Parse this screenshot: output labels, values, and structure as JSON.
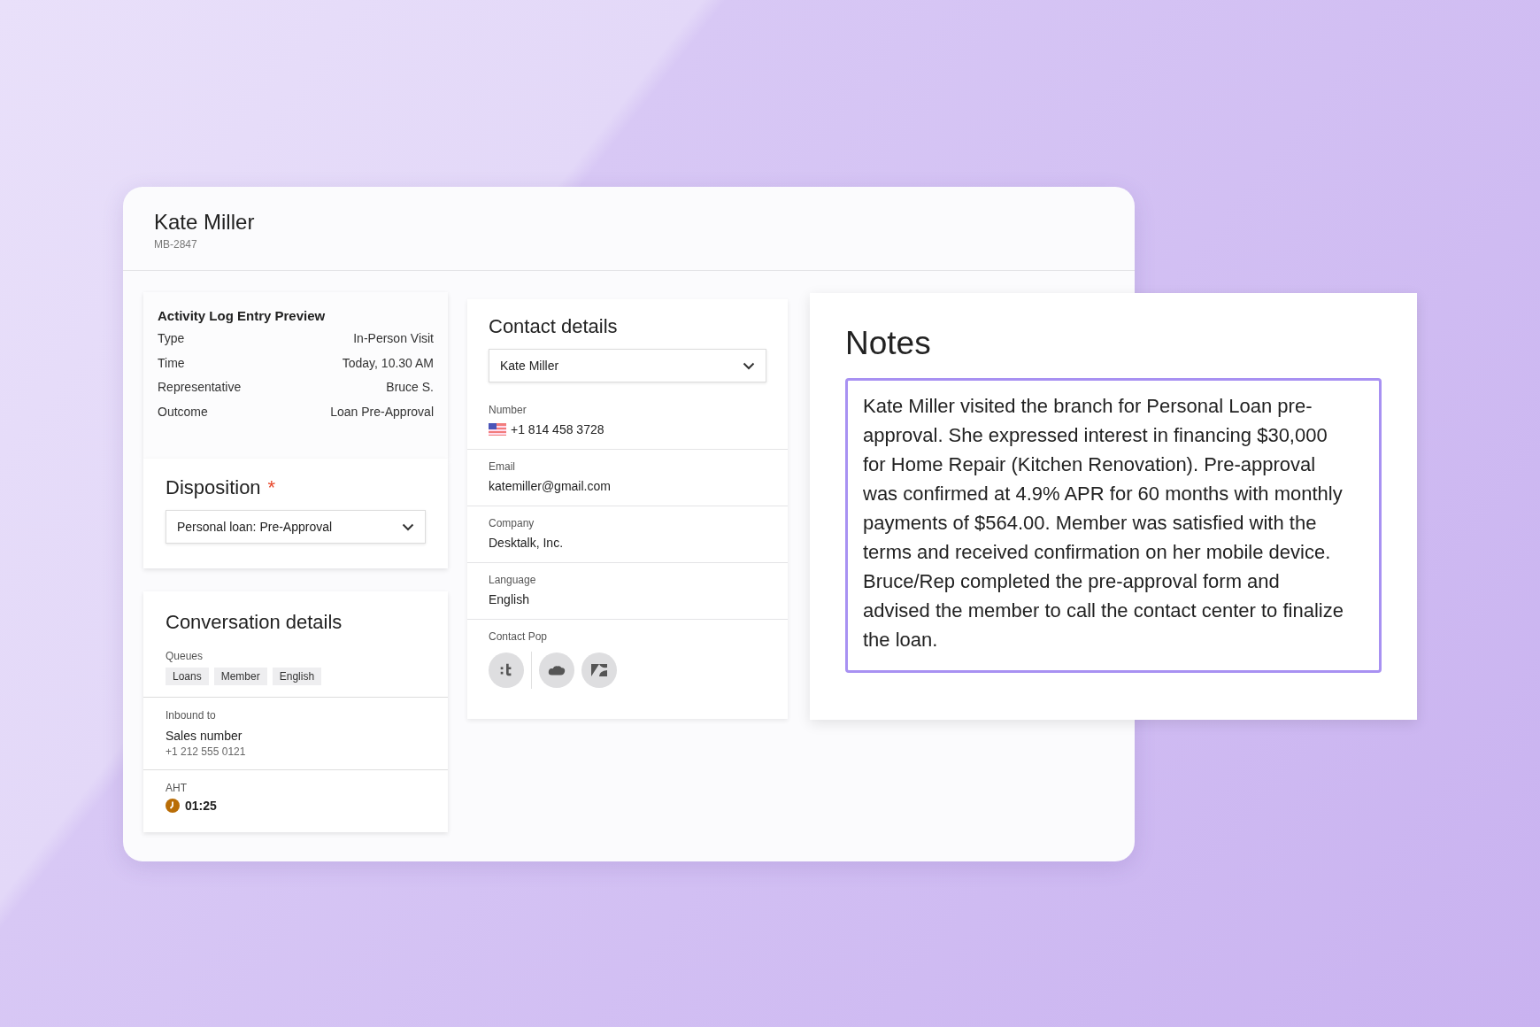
{
  "header": {
    "name": "Kate Miller",
    "id": "MB-2847"
  },
  "activity_log": {
    "title": "Activity Log Entry Preview",
    "rows": [
      {
        "label": "Type",
        "value": "In-Person Visit"
      },
      {
        "label": "Time",
        "value": "Today, 10.30 AM"
      },
      {
        "label": "Representative",
        "value": "Bruce S."
      },
      {
        "label": "Outcome",
        "value": "Loan Pre-Approval"
      }
    ]
  },
  "disposition": {
    "title": "Disposition",
    "required_mark": "*",
    "value": "Personal loan: Pre-Approval"
  },
  "conversation": {
    "title": "Conversation details",
    "queues_label": "Queues",
    "queues": [
      "Loans",
      "Member",
      "English"
    ],
    "inbound_label": "Inbound to",
    "inbound_name": "Sales number",
    "inbound_number": "+1 212 555 0121",
    "aht_label": "AHT",
    "aht_value": "01:25"
  },
  "contact": {
    "title": "Contact details",
    "selected_contact": "Kate Miller",
    "fields": [
      {
        "label": "Number",
        "value": "+1 814 458 3728",
        "kind": "phone"
      },
      {
        "label": "Email",
        "value": "katemiller@gmail.com",
        "kind": "text"
      },
      {
        "label": "Company",
        "value": "Desktalk, Inc.",
        "kind": "text"
      },
      {
        "label": "Language",
        "value": "English",
        "kind": "text"
      }
    ],
    "contact_pop_label": "Contact Pop",
    "contact_pop": [
      {
        "kind": "dots-t"
      },
      {
        "kind": "cloud"
      },
      {
        "kind": "zigzag"
      }
    ]
  },
  "notes": {
    "title": "Notes",
    "text": "Kate Miller visited the branch for Personal Loan pre-approval. She expressed interest in financing $30,000 for Home Repair (Kitchen Renovation). Pre-approval was confirmed at 4.9% APR for 60 months with monthly payments of $564.00. Member was satisfied with the terms and received confirmation on her mobile device. Bruce/Rep completed the pre-approval form and advised the member to call the contact center to finalize the loan."
  }
}
